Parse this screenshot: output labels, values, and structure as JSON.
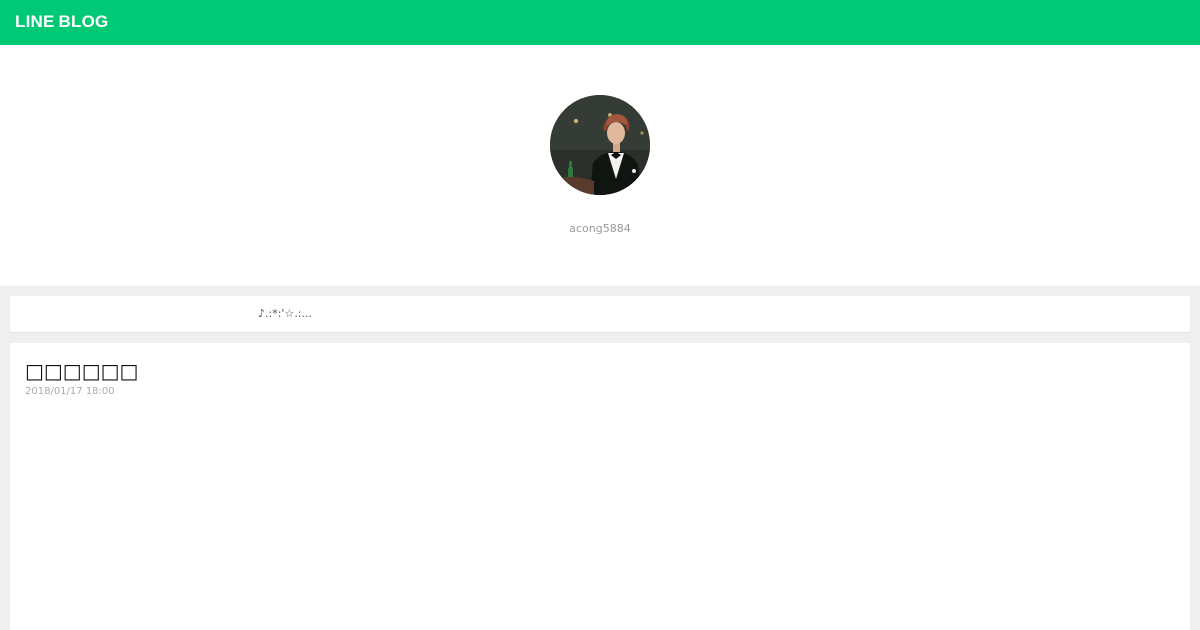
{
  "header": {
    "logo_line": "LINE",
    "logo_blog": "BLOG",
    "brand_color": "#00c975"
  },
  "profile": {
    "avatar_icon": "profile-photo",
    "username": "acong5884"
  },
  "description": {
    "text": "♪.:*:'☆.:..."
  },
  "post": {
    "title": "□□□□□□",
    "date": "2018/01/17 18:00"
  }
}
